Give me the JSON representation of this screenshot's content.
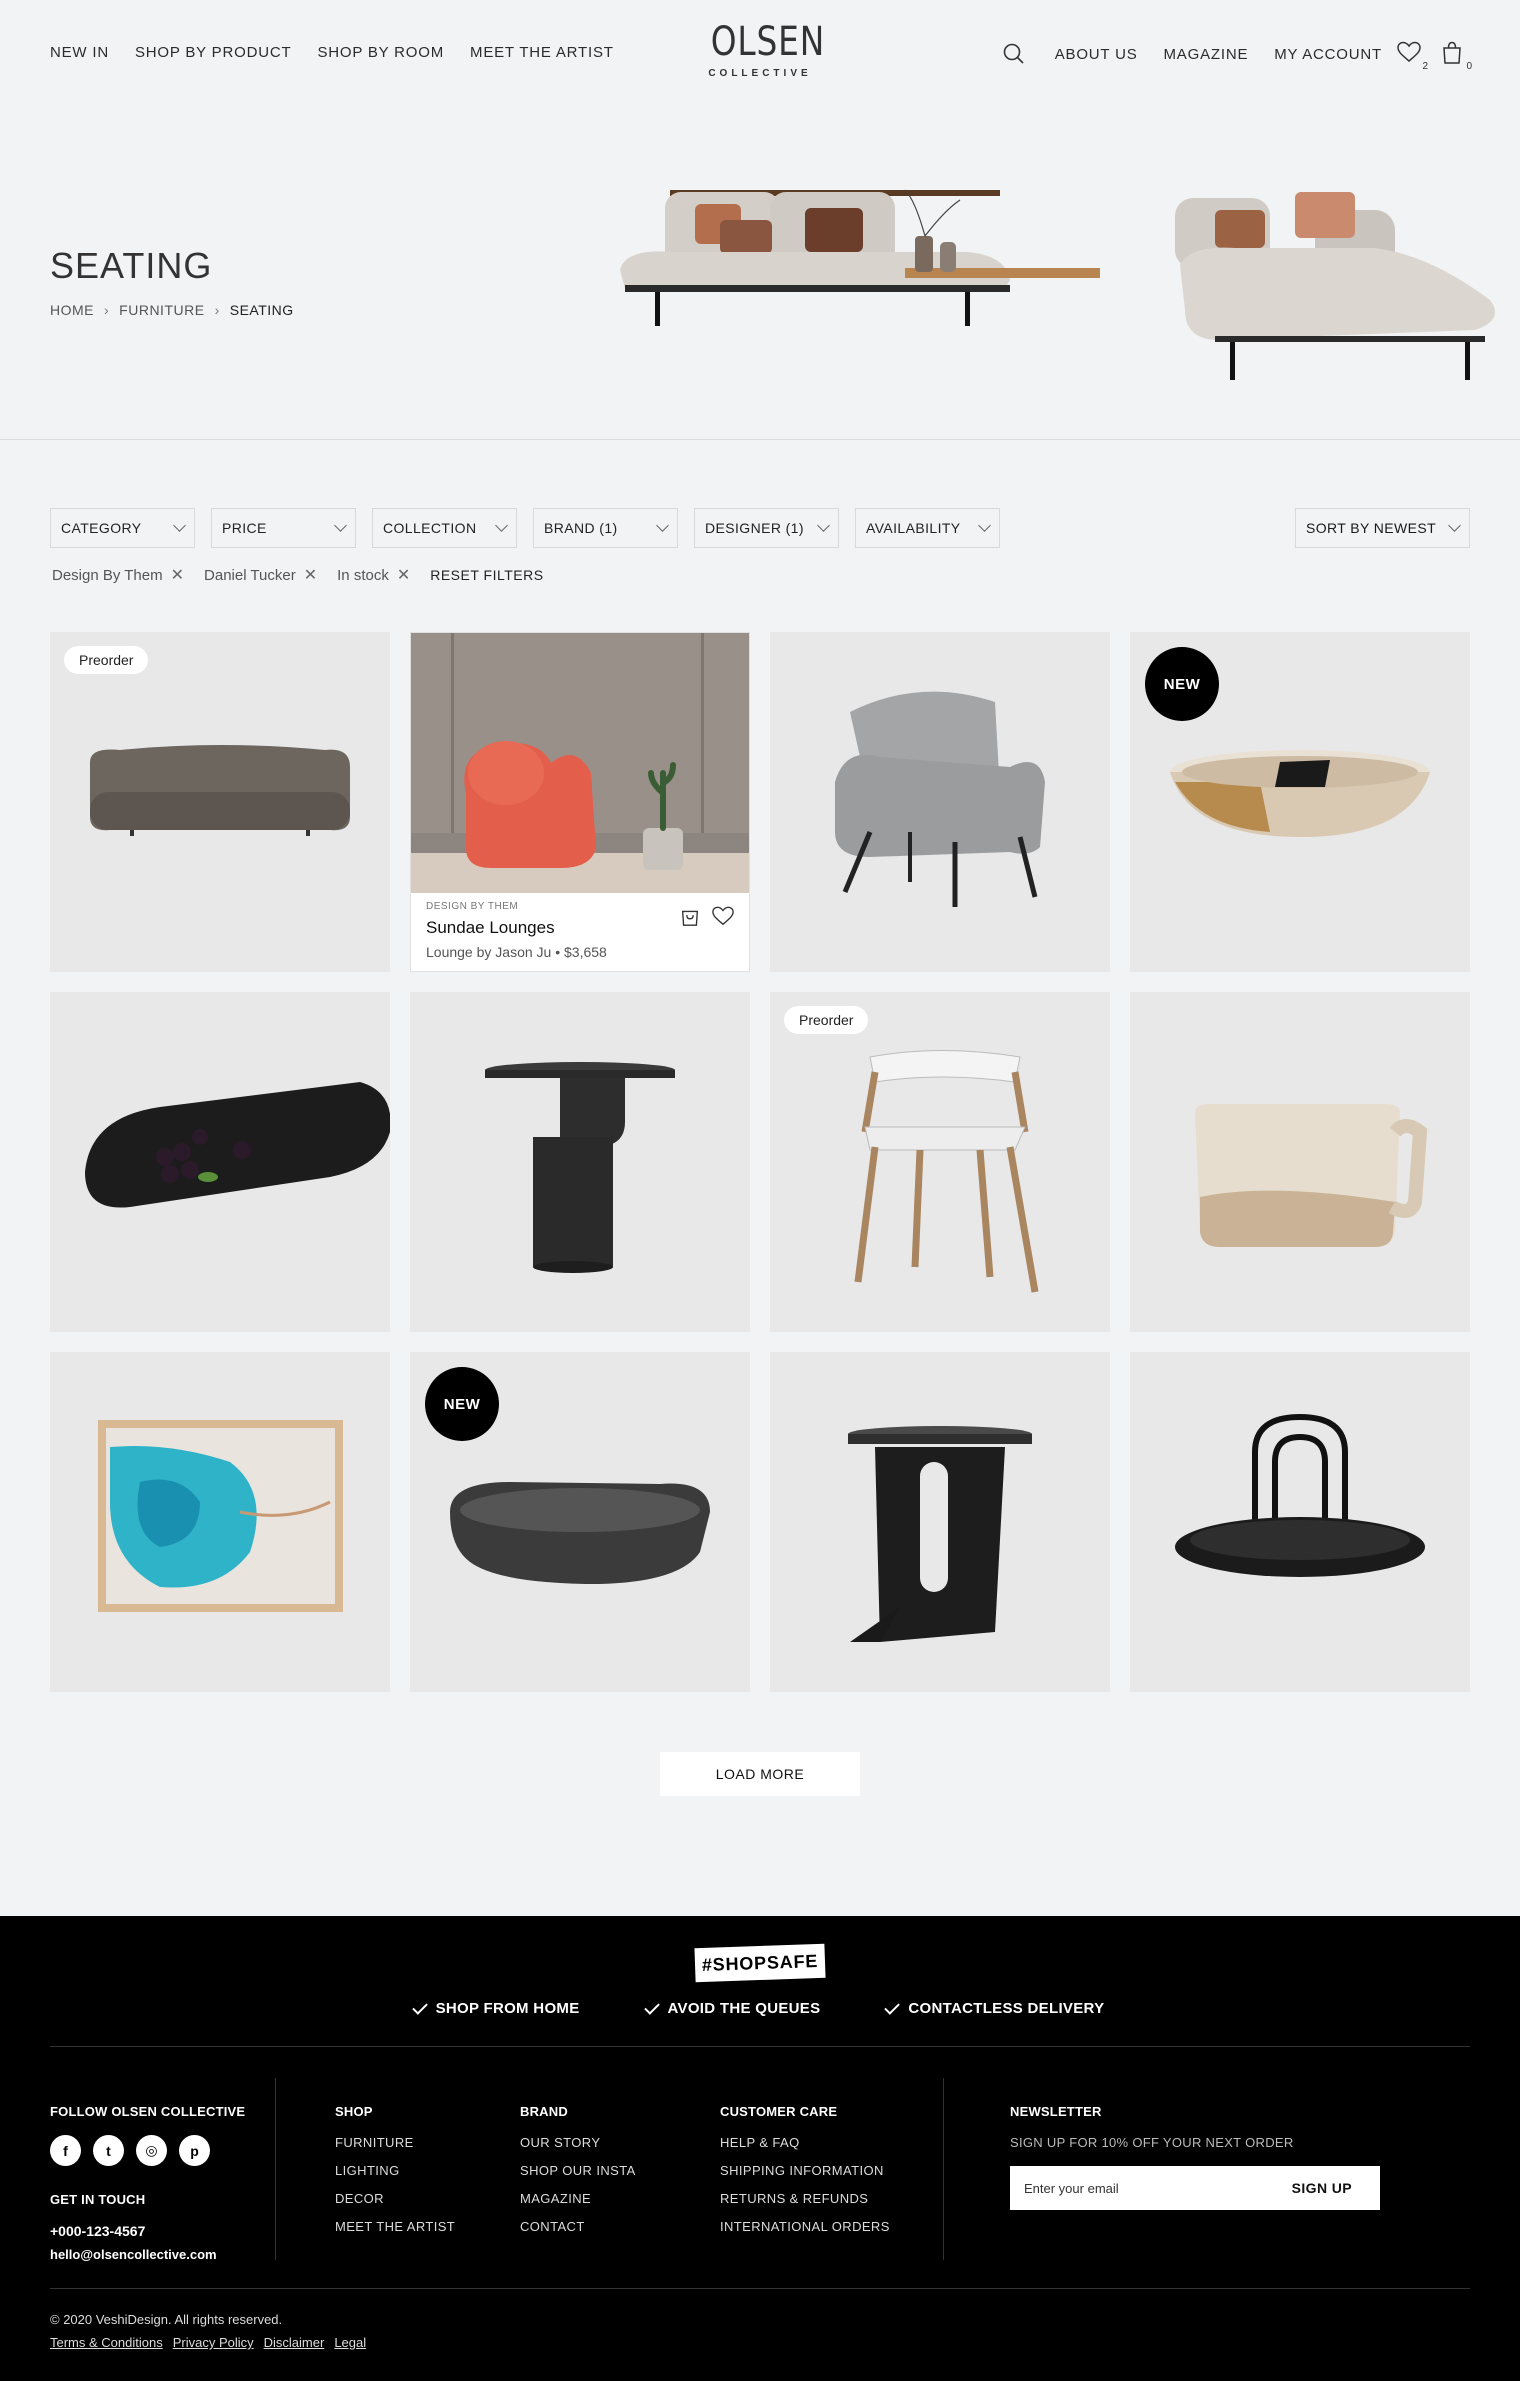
{
  "header": {
    "nav_left": [
      "NEW IN",
      "SHOP BY PRODUCT",
      "SHOP BY ROOM",
      "MEET THE ARTIST"
    ],
    "logo_main": "OLSEN",
    "logo_sub": "COLLECTIVE",
    "nav_right": [
      "ABOUT US",
      "MAGAZINE",
      "MY ACCOUNT"
    ],
    "wishlist_count": "2",
    "cart_count": "0"
  },
  "hero": {
    "title": "SEATING",
    "breadcrumb": [
      "HOME",
      "FURNITURE",
      "SEATING"
    ]
  },
  "filters": {
    "items": [
      "CATEGORY",
      "PRICE",
      "COLLECTION",
      "BRAND (1)",
      "DESIGNER (1)",
      "AVAILABILITY"
    ],
    "sort": "SORT BY NEWEST",
    "active": [
      "Design By Them",
      "Daniel Tucker",
      "In stock"
    ],
    "reset": "RESET FILTERS"
  },
  "products": {
    "badge_preorder": "Preorder",
    "badge_new": "NEW",
    "featured": {
      "designer": "DESIGN BY THEM",
      "name": "Sundae Lounges",
      "sub": "Lounge by Jason Ju • $3,658"
    },
    "load_more": "LOAD MORE"
  },
  "footer": {
    "shopsafe": "#SHOPSAFE",
    "perks": [
      "SHOP FROM HOME",
      "AVOID THE QUEUES",
      "CONTACTLESS DELIVERY"
    ],
    "follow_title": "FOLLOW OLSEN COLLECTIVE",
    "socials": [
      "f",
      "t",
      "◎",
      "p"
    ],
    "touch_title": "GET IN TOUCH",
    "phone": "+000-123-4567",
    "email": "hello@olsencollective.com",
    "shop": {
      "title": "SHOP",
      "links": [
        "FURNITURE",
        "LIGHTING",
        "DECOR",
        "MEET THE ARTIST"
      ]
    },
    "brand": {
      "title": "BRAND",
      "links": [
        "OUR STORY",
        "SHOP OUR INSTA",
        "MAGAZINE",
        "CONTACT"
      ]
    },
    "care": {
      "title": "CUSTOMER CARE",
      "links": [
        "HELP & FAQ",
        "SHIPPING INFORMATION",
        "RETURNS & REFUNDS",
        "INTERNATIONAL ORDERS"
      ]
    },
    "newsletter": {
      "title": "NEWSLETTER",
      "sub": "SIGN UP FOR 10% OFF YOUR NEXT ORDER",
      "placeholder": "Enter your email",
      "button": "SIGN UP"
    },
    "copyright": "© 2020 VeshiDesign. All rights reserved.",
    "legal": [
      "Terms & Conditions",
      "Privacy Policy",
      "Disclaimer",
      "Legal"
    ]
  }
}
